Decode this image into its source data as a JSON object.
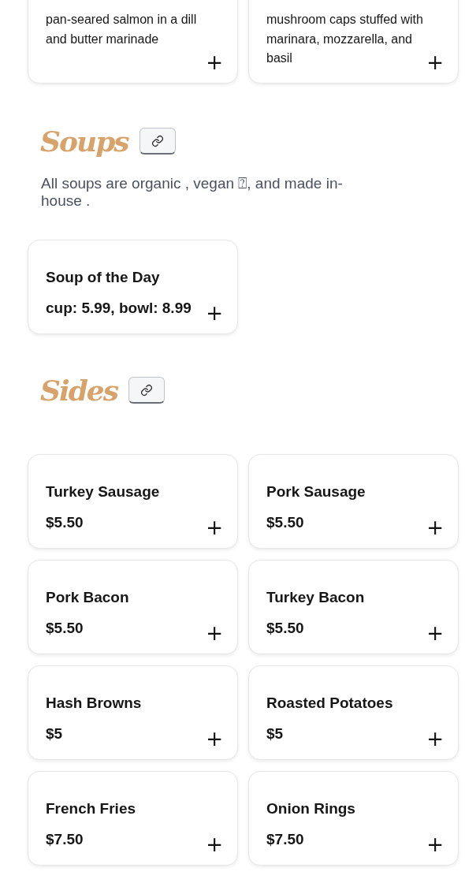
{
  "top_items": [
    {
      "description": "pan-seared salmon in a dill and butter marinade",
      "add": "+"
    },
    {
      "description": "mushroom caps stuffed with marinara, mozzarella, and basil",
      "add": "+"
    }
  ],
  "sections": [
    {
      "title": "Soups",
      "note": "All soups are organic , vegan ⍰, and made in-house .",
      "items": [
        {
          "name": "Soup of the Day",
          "price": "cup: 5.99, bowl: 8.99",
          "add": "+"
        }
      ]
    },
    {
      "title": "Sides",
      "items": [
        {
          "name": "Turkey Sausage",
          "price": "$5.50",
          "add": "+"
        },
        {
          "name": "Pork Sausage",
          "price": "$5.50",
          "add": "+"
        },
        {
          "name": "Pork Bacon",
          "price": "$5.50",
          "add": "+"
        },
        {
          "name": "Turkey Bacon",
          "price": "$5.50",
          "add": "+"
        },
        {
          "name": "Hash Browns",
          "price": "$5",
          "add": "+"
        },
        {
          "name": "Roasted Potatoes",
          "price": "$5",
          "add": "+"
        },
        {
          "name": "French Fries",
          "price": "$7.50",
          "add": "+"
        },
        {
          "name": "Onion Rings",
          "price": "$7.50",
          "add": "+"
        }
      ]
    }
  ]
}
